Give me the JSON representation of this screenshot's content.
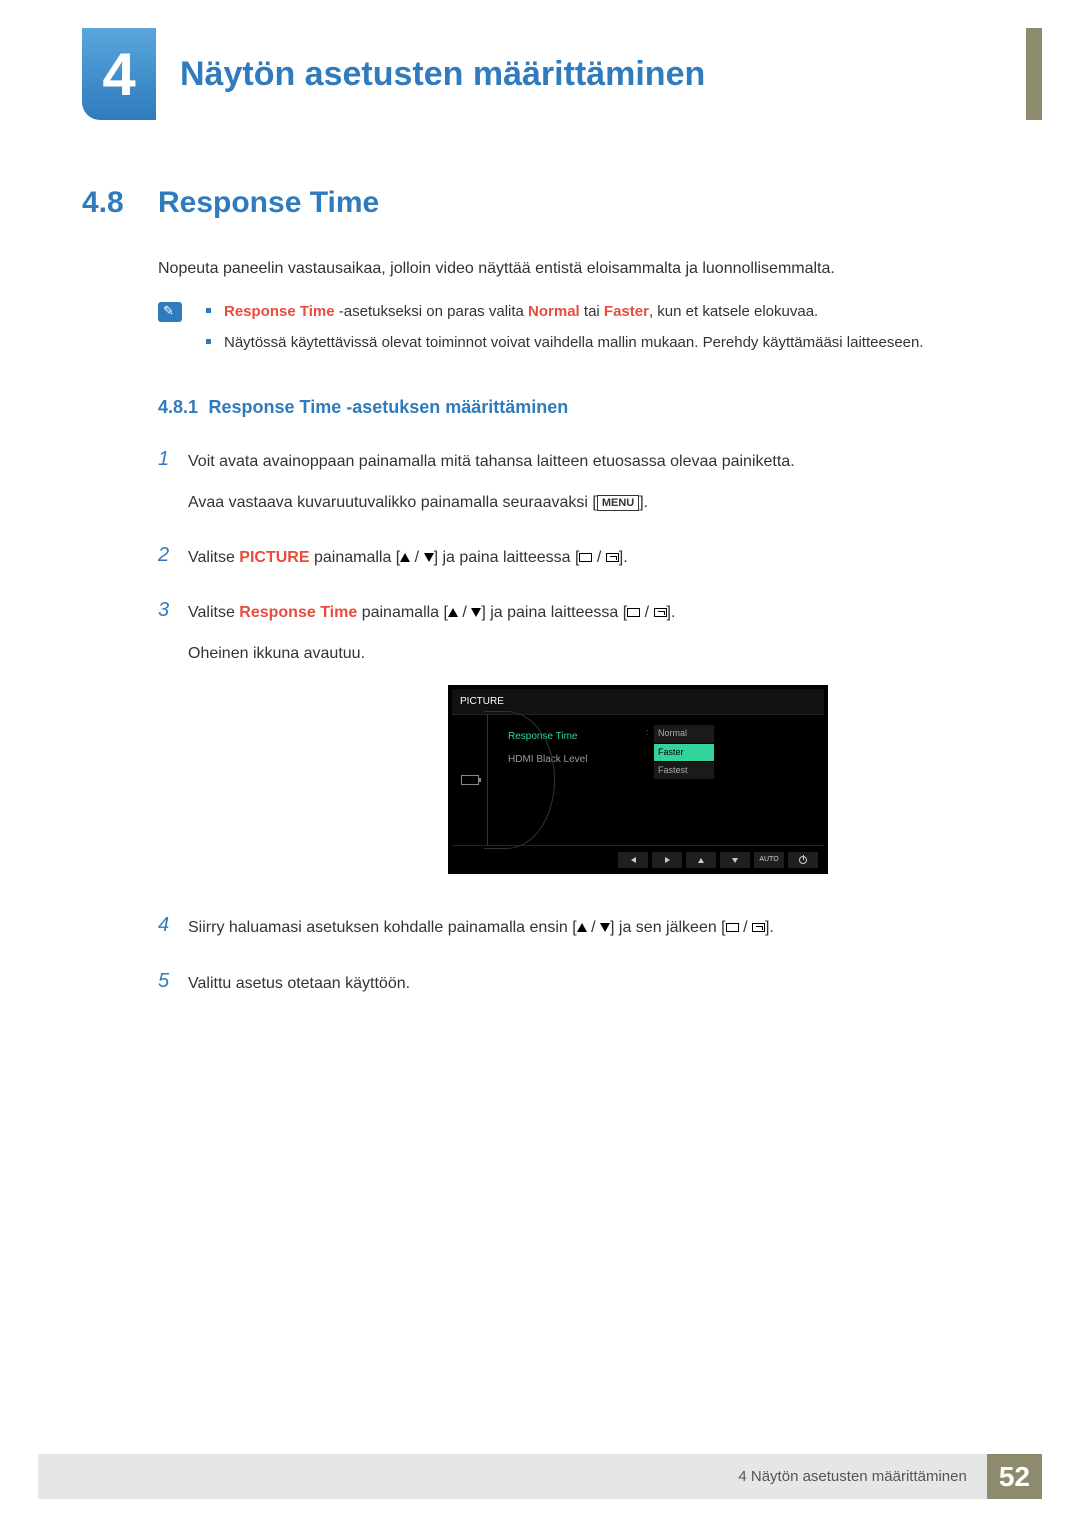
{
  "chapter": {
    "number": "4",
    "title": "Näytön asetusten määrittäminen"
  },
  "section": {
    "number": "4.8",
    "title": "Response Time"
  },
  "intro": "Nopeuta paneelin vastausaikaa, jolloin video näyttää entistä eloisammalta ja luonnollisemmalta.",
  "note": {
    "bullet1_prefix": "Response Time",
    "bullet1_mid1": " -asetukseksi on paras valita ",
    "bullet1_normal": "Normal",
    "bullet1_or": " tai ",
    "bullet1_faster": "Faster",
    "bullet1_suffix": ", kun et katsele elokuvaa.",
    "bullet2": "Näytössä käytettävissä olevat toiminnot voivat vaihdella mallin mukaan. Perehdy käyttämääsi laitteeseen."
  },
  "subsection": {
    "number": "4.8.1",
    "title": "Response Time -asetuksen määrittäminen"
  },
  "steps": {
    "s1a": "Voit avata avainoppaan painamalla mitä tahansa laitteen etuosassa olevaa painiketta.",
    "s1b_prefix": "Avaa vastaava kuvaruutuvalikko painamalla seuraavaksi [",
    "s1b_menu": "MENU",
    "s1b_suffix": "].",
    "s2_prefix": "Valitse ",
    "s2_picture": "PICTURE",
    "s2_mid": " painamalla [",
    "s2_mid2": "] ja paina laitteessa [",
    "s2_suffix": "].",
    "s3_prefix": "Valitse ",
    "s3_rt": "Response Time",
    "s3_mid": " painamalla [",
    "s3_mid2": "] ja paina laitteessa [",
    "s3_suffix": "].",
    "s3_follow": "Oheinen ikkuna avautuu.",
    "s4_prefix": "Siirry haluamasi asetuksen kohdalle painamalla ensin [",
    "s4_mid": "] ja sen jälkeen [",
    "s4_suffix": "].",
    "s5": "Valittu asetus otetaan käyttöön."
  },
  "osd": {
    "header": "PICTURE",
    "item1": "Response Time",
    "item2": "HDMI Black Level",
    "opt1": "Normal",
    "opt2": "Faster",
    "opt3": "Fastest",
    "auto": "AUTO"
  },
  "footer": {
    "text": "4 Näytön asetusten määrittäminen",
    "page": "52"
  }
}
